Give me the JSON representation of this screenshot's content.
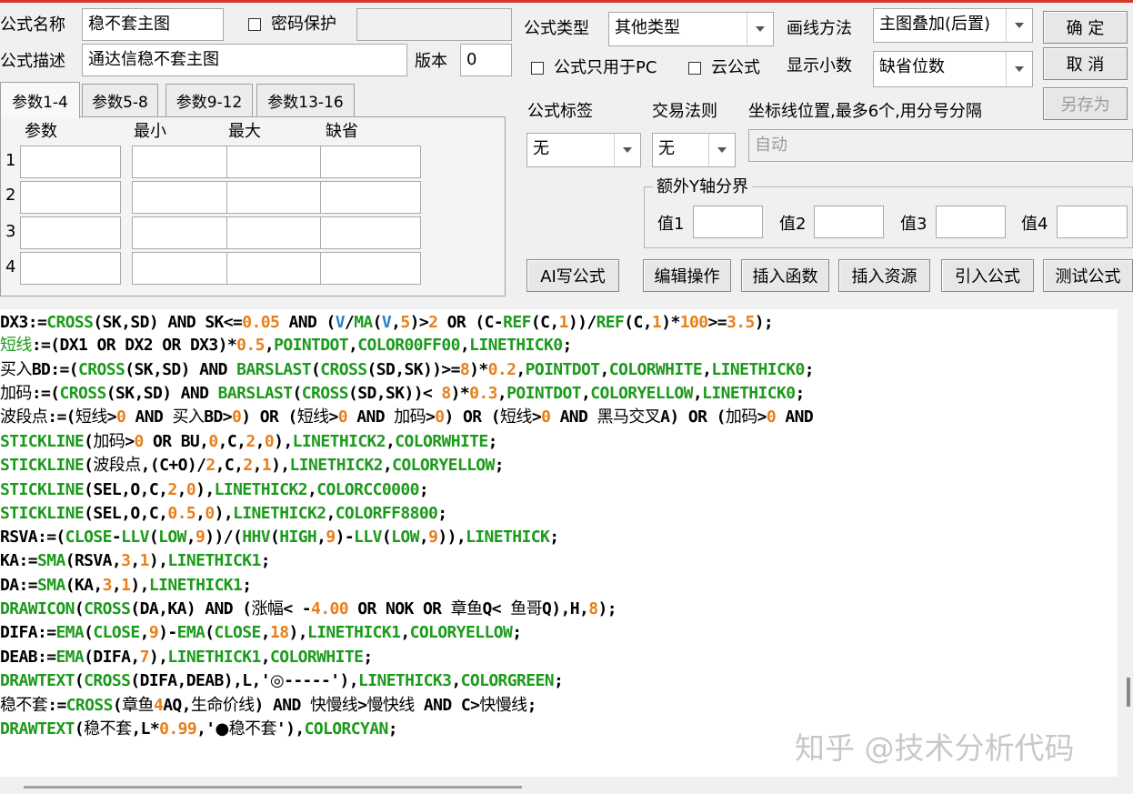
{
  "form": {
    "name_label": "公式名称",
    "name_value": "稳不套主图",
    "password_label": "密码保护",
    "desc_label": "公式描述",
    "desc_value": "通达信稳不套主图",
    "version_label": "版本",
    "version_value": "0",
    "type_label": "公式类型",
    "type_value": "其他类型",
    "draw_label": "画线方法",
    "draw_value": "主图叠加(后置)",
    "pc_only_label": "公式只用于PC",
    "cloud_label": "云公式",
    "decimals_label": "显示小数",
    "decimals_value": "缺省位数",
    "tag_label": "公式标签",
    "tag_value": "无",
    "trade_label": "交易法则",
    "trade_value": "无",
    "coord_label": "坐标线位置,最多6个,用分号分隔",
    "coord_value": "自动",
    "yaxis_label": "额外Y轴分界",
    "val1": "值1",
    "val2": "值2",
    "val3": "值3",
    "val4": "值4"
  },
  "buttons": {
    "ok": "确 定",
    "cancel": "取 消",
    "save_as": "另存为",
    "ai": "AI写公式",
    "edit": "编辑操作",
    "insert_func": "插入函数",
    "insert_res": "插入资源",
    "import": "引入公式",
    "test": "测试公式"
  },
  "tabs": [
    "参数1-4",
    "参数5-8",
    "参数9-12",
    "参数13-16"
  ],
  "params": {
    "headers": [
      "参数",
      "最小",
      "最大",
      "缺省"
    ],
    "rows": [
      "1",
      "2",
      "3",
      "4"
    ]
  },
  "code_lines": [
    "DX3:=CROSS(SK,SD) AND SK<=0.05 AND (V/MA(V,5)>2 OR (C-REF(C,1))/REF(C,1)*100>=3.5);",
    "短线:=(DX1 OR DX2 OR DX3)*0.5,POINTDOT,COLOR00FF00,LINETHICK0;",
    "买入BD:=(CROSS(SK,SD) AND BARSLAST(CROSS(SD,SK))>=8)*0.2,POINTDOT,COLORWHITE,LINETHICK0;",
    "加码:=(CROSS(SK,SD) AND BARSLAST(CROSS(SD,SK))< 8)*0.3,POINTDOT,COLORYELLOW,LINETHICK0;",
    "波段点:=(短线>0 AND 买入BD>0) OR (短线>0 AND 加码>0) OR (短线>0 AND 黑马交叉A) OR (加码>0 AND",
    "STICKLINE(加码>0 OR BU,0,C,2,0),LINETHICK2,COLORWHITE;",
    "STICKLINE(波段点,(C+O)/2,C,2,1),LINETHICK2,COLORYELLOW;",
    "STICKLINE(SEL,O,C,2,0),LINETHICK2,COLORCC0000;",
    "STICKLINE(SEL,O,C,0.5,0),LINETHICK2,COLORFF8800;",
    "RSVA:=(CLOSE-LLV(LOW,9))/(HHV(HIGH,9)-LLV(LOW,9)),LINETHICK;",
    "KA:=SMA(RSVA,3,1),LINETHICK1;",
    "DA:=SMA(KA,3,1),LINETHICK1;",
    "DRAWICON(CROSS(DA,KA) AND (涨幅< -4.00 OR NOK OR 章鱼Q< 鱼哥Q),H,8);",
    "DIFA:=EMA(CLOSE,9)-EMA(CLOSE,18),LINETHICK1,COLORYELLOW;",
    "DEAB:=EMA(DIFA,7),LINETHICK1,COLORWHITE;",
    "DRAWTEXT(CROSS(DIFA,DEAB),L,'◎-----'),LINETHICK3,COLORGREEN;",
    "稳不套:=CROSS(章鱼4AQ,生命价线) AND 快慢线>慢快线 AND C>快慢线;",
    "DRAWTEXT(稳不套,L*0.99,'●稳不套'),COLORCYAN;"
  ],
  "watermark": "知乎 @技术分析代码",
  "colors": {
    "keyword": "#000000",
    "function": "#1c9a1c",
    "number": "#e87f1a",
    "builtin": "#2a7fc6",
    "accent_red": "#d23a2a"
  }
}
